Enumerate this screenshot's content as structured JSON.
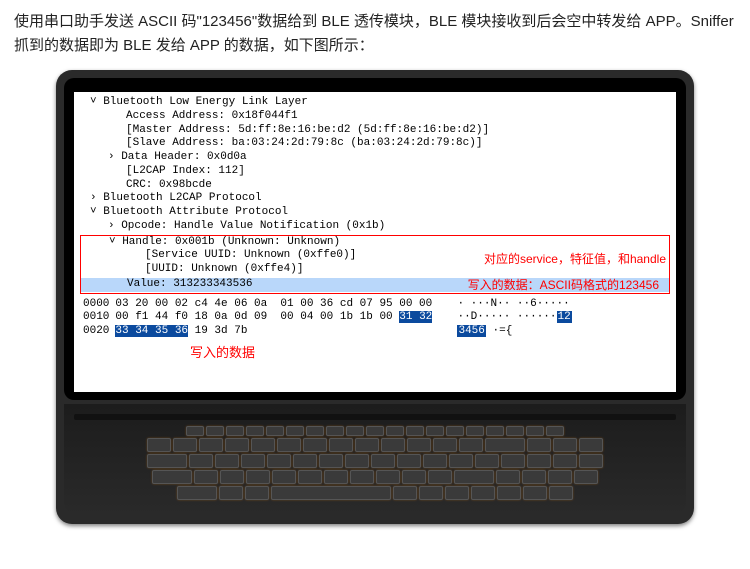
{
  "intro": "使用串口助手发送 ASCII 码\"123456\"数据给到 BLE 透传模块，BLE 模块接收到后会空中转发给 APP。Sniffer 抓到的数据即为 BLE 发给 APP 的数据，如下图所示：",
  "tree": {
    "l0": "Bluetooth Low Energy Link Layer",
    "l1": "Access Address: 0x18f044f1",
    "l2": "[Master Address: 5d:ff:8e:16:be:d2 (5d:ff:8e:16:be:d2)]",
    "l3": "[Slave Address: ba:03:24:2d:79:8c (ba:03:24:2d:79:8c)]",
    "l4": "Data Header: 0x0d0a",
    "l5": "[L2CAP Index: 112]",
    "l6": "CRC: 0x98bcde",
    "l7": "Bluetooth L2CAP Protocol",
    "l8": "Bluetooth Attribute Protocol",
    "l9": "Opcode: Handle Value Notification (0x1b)",
    "l10": "Handle: 0x001b (Unknown: Unknown)",
    "l11": "[Service UUID: Unknown (0xffe0)]",
    "l12": "[UUID: Unknown (0xffe4)]",
    "l13": "Value: 313233343536"
  },
  "annot": {
    "svc": "对应的service，特征值，和handle",
    "write": "写入的数据：ASCII码格式的123456",
    "bottom": "写入的数据"
  },
  "hex": {
    "r0": {
      "off": "0000",
      "b": "03 20 00 02 c4 4e 06 0a  01 00 36 cd 07 95 00 00",
      "a": "· ···N·· ··6·····"
    },
    "r1": {
      "off": "0010",
      "b_plain": "00 f1 44 f0 18 0a 0d 09  00 04 00 1b 1b 00 ",
      "b_sel": "31 32",
      "a_plain": "··D····· ······",
      "a_sel": "12"
    },
    "r2": {
      "off": "0020",
      "b_sel": "33 34 35 36",
      "b_plain": " 19 3d 7b",
      "a_sel": "3456",
      "a_plain": " ·={"
    }
  }
}
